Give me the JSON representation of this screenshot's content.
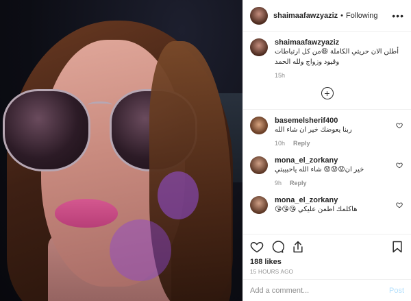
{
  "post": {
    "author": "shaimaafawzyaziz",
    "follow_status": "Following",
    "separator": "•",
    "more_glyph": "•••",
    "photo_alt": "selfie photo",
    "caption": {
      "username": "shaimaafawzyaziz",
      "text": "أطلن الان حريتي الكاملة 😆من كل ارتباطات وقيود وزواج ولله الحمد",
      "time": "15h"
    },
    "load_more_glyph": "+",
    "comments": [
      {
        "username": "basemelsherif400",
        "text": "ربنا يعوضك خير ان شاء الله",
        "time": "10h",
        "reply_label": "Reply"
      },
      {
        "username": "mona_el_zorkany",
        "text": "خير ان😟😟😟 شاء الله ياحبيبتي",
        "time": "9h",
        "reply_label": "Reply"
      },
      {
        "username": "mona_el_zorkany",
        "text": "هاكلمك اطمن عليكي 😘😘😘",
        "time": "",
        "reply_label": ""
      }
    ],
    "likes": "188 likes",
    "timestamp": "15 HOURS AGO",
    "comment_placeholder": "Add a comment...",
    "post_label": "Post"
  },
  "icons": {
    "like": "heart-icon",
    "comment": "comment-icon",
    "share": "share-icon",
    "save": "bookmark-icon",
    "more": "more-icon",
    "add": "plus-circle-icon"
  },
  "colors": {
    "text": "#262626",
    "muted": "#8e8e8e",
    "post_button_disabled": "#b2dffc",
    "border": "#efefef"
  }
}
